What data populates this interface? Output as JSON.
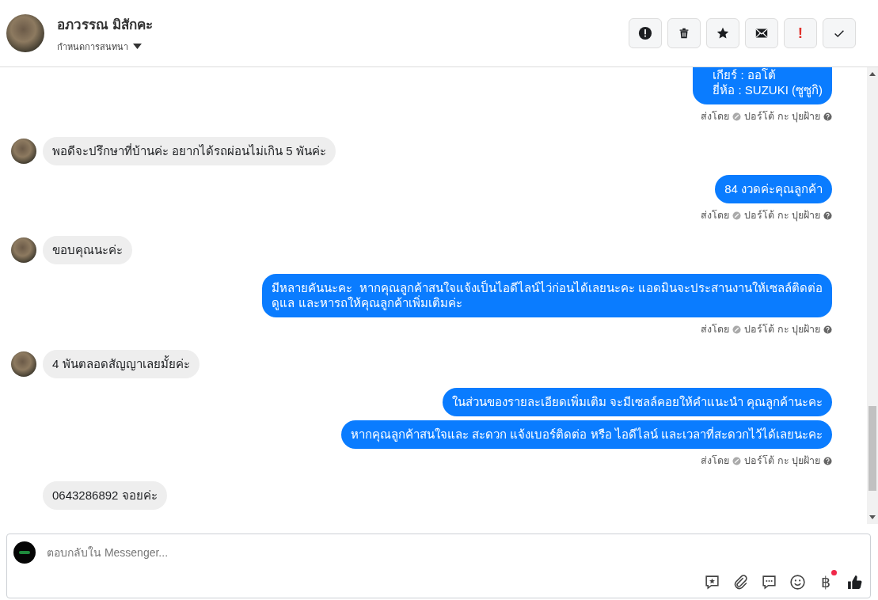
{
  "header": {
    "name": "อภวรรณ มิสักคะ",
    "subtitle": "กำหนดการสนทนา",
    "actions": [
      {
        "kind": "alert"
      },
      {
        "kind": "trash"
      },
      {
        "kind": "star"
      },
      {
        "kind": "mail"
      },
      {
        "kind": "text",
        "label": "!"
      },
      {
        "kind": "check"
      }
    ]
  },
  "messages": [
    {
      "kind": "outgoing",
      "cut_top": true,
      "bubbles": [
        "เกียร์ : ออโต้\nยี่ห้อ : SUZUKI (ซูซูกิ)"
      ],
      "sent_by": "ส่งโดย",
      "sender": "ปอร์โต้ กะ ปุยฝ้าย"
    },
    {
      "kind": "incoming",
      "avatar": true,
      "bubbles": [
        "พอดีจะปรึกษาที่บ้านค่ะ อยากได้รถผ่อนไม่เกิน 5 พันค่ะ"
      ]
    },
    {
      "kind": "outgoing",
      "cut_top": false,
      "bubbles": [
        "84 งวดค่ะคุณลูกค้า"
      ],
      "sent_by": "ส่งโดย",
      "sender": "ปอร์โต้ กะ ปุยฝ้าย"
    },
    {
      "kind": "incoming",
      "avatar": true,
      "bubbles": [
        "ขอบคุณนะค่ะ"
      ]
    },
    {
      "kind": "outgoing",
      "cut_top": false,
      "bubbles": [
        "มีหลายคันนะคะ  หากคุณลูกค้าสนใจแจ้งเป็นไอดีไลน์ไว่ก่อนได้เลยนะคะ แอดมินจะประสานงานให้เซลล์ติดต่อ\nดูแล และหารถให้คุณลูกค้าเพิ่มเติมค่ะ"
      ],
      "sent_by": "ส่งโดย",
      "sender": "ปอร์โต้ กะ ปุยฝ้าย"
    },
    {
      "kind": "incoming",
      "avatar": true,
      "bubbles": [
        "4 พันตลอดสัญญาเลยมั้ยค่ะ"
      ]
    },
    {
      "kind": "outgoing",
      "cut_top": false,
      "bubbles": [
        "ในส่วนของรายละเอียดเพิ่มเติม จะมีเซลล์คอยให้คำแนะนำ คุณลูกค้านะคะ",
        "หากคุณลูกค้าสนใจและ สะดวก แจ้งเบอร์ติดต่อ หรือ ไอดีไลน์ และเวลาที่สะดวกไว้ได้เลยนะคะ"
      ],
      "sent_by": "ส่งโดย",
      "sender": "ปอร์โต้ กะ ปุยฝ้าย"
    },
    {
      "kind": "incoming",
      "avatar": false,
      "bubbles": [
        "0643286892 จอยค่ะ"
      ]
    }
  ],
  "composer": {
    "placeholder": "ตอบกลับใน Messenger...",
    "tools": [
      {
        "kind": "saved-reply"
      },
      {
        "kind": "attach"
      },
      {
        "kind": "chat"
      },
      {
        "kind": "emoji"
      },
      {
        "kind": "text",
        "label": "฿",
        "badge": true
      },
      {
        "kind": "like"
      }
    ]
  }
}
